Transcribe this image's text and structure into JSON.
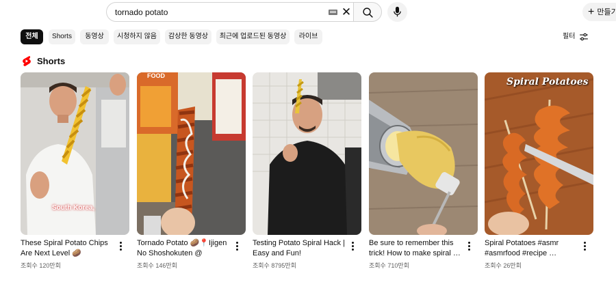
{
  "search": {
    "query": "tornado potato",
    "clear_icon": "close-icon",
    "keyboard_icon": "keyboard-icon",
    "submit_icon": "search-icon",
    "voice_icon": "microphone-icon"
  },
  "header": {
    "create_label": "만들기",
    "create_icon": "plus-icon"
  },
  "chips": [
    {
      "label": "전체",
      "active": true
    },
    {
      "label": "Shorts",
      "active": false
    },
    {
      "label": "동영상",
      "active": false
    },
    {
      "label": "시청하지 않음",
      "active": false
    },
    {
      "label": "감상한 동영상",
      "active": false
    },
    {
      "label": "최근에 업로드된 동영상",
      "active": false
    },
    {
      "label": "라이브",
      "active": false
    }
  ],
  "filter": {
    "label": "필터",
    "icon": "sliders-icon"
  },
  "shorts": {
    "title": "Shorts",
    "logo_icon": "shorts-logo-icon",
    "items": [
      {
        "title": "These Spiral Potato Chips Are Next Level 🥔",
        "views": "조회수 120만회",
        "overlay": "South Korea,"
      },
      {
        "title": "Tornado Potato 🥔📍Ijigen No Shoshokuten @ Haow…",
        "views": "조회수 146만회",
        "overlay": "FOOD"
      },
      {
        "title": "Testing Potato Spiral Hack | Easy and Fun!",
        "views": "조회수 8795만회",
        "overlay": ""
      },
      {
        "title": "Be sure to remember this trick! How to make spiral …",
        "views": "조회수 710만회",
        "overlay": ""
      },
      {
        "title": "Spiral Potatoes #asmr #asmrfood #recipe …",
        "views": "조회수 26만회",
        "overlay": "Spiral Potatoes"
      }
    ]
  },
  "colors": {
    "accent": "#ff0000",
    "chip_bg": "#f2f2f2",
    "chip_active": "#0f0f0f",
    "meta": "#606060"
  }
}
